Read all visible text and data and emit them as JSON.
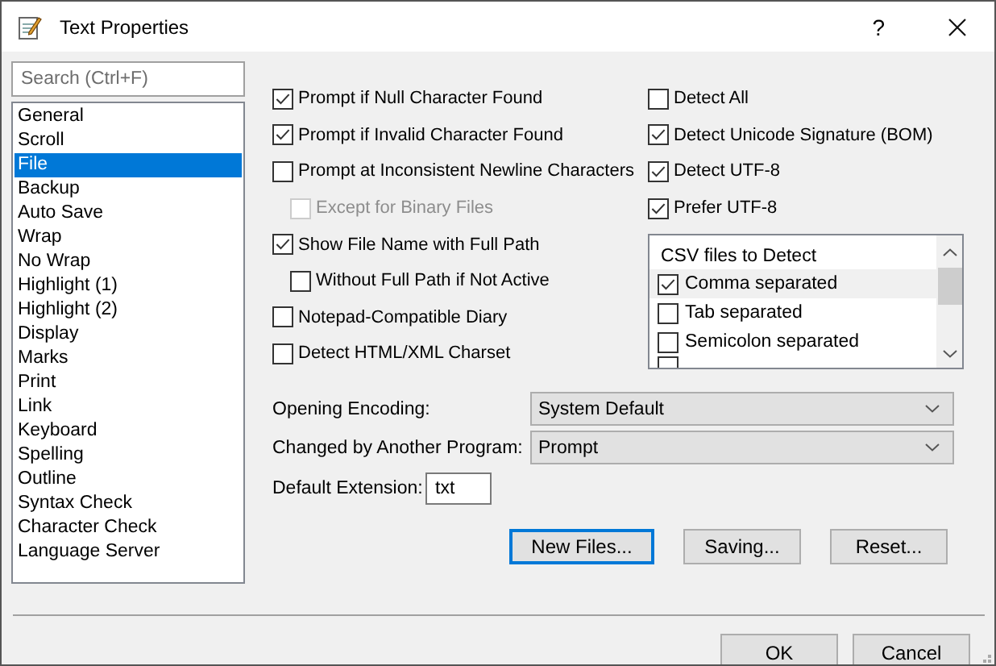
{
  "window": {
    "title": "Text Properties",
    "help": "?"
  },
  "search": {
    "placeholder": "Search (Ctrl+F)"
  },
  "categories": [
    {
      "label": "General",
      "selected": false
    },
    {
      "label": "Scroll",
      "selected": false
    },
    {
      "label": "File",
      "selected": true
    },
    {
      "label": "Backup",
      "selected": false
    },
    {
      "label": "Auto Save",
      "selected": false
    },
    {
      "label": "Wrap",
      "selected": false
    },
    {
      "label": "No Wrap",
      "selected": false
    },
    {
      "label": "Highlight (1)",
      "selected": false
    },
    {
      "label": "Highlight (2)",
      "selected": false
    },
    {
      "label": "Display",
      "selected": false
    },
    {
      "label": "Marks",
      "selected": false
    },
    {
      "label": "Print",
      "selected": false
    },
    {
      "label": "Link",
      "selected": false
    },
    {
      "label": "Keyboard",
      "selected": false
    },
    {
      "label": "Spelling",
      "selected": false
    },
    {
      "label": "Outline",
      "selected": false
    },
    {
      "label": "Syntax Check",
      "selected": false
    },
    {
      "label": "Character Check",
      "selected": false
    },
    {
      "label": "Language Server",
      "selected": false
    }
  ],
  "left_options": [
    {
      "label": "Prompt if Null Character Found",
      "checked": true,
      "disabled": false
    },
    {
      "label": "Prompt if Invalid Character Found",
      "checked": true,
      "disabled": false
    },
    {
      "label": "Prompt at Inconsistent Newline Characters",
      "checked": false,
      "disabled": false,
      "children": [
        {
          "label": "Except for Binary Files",
          "checked": false,
          "disabled": true
        }
      ]
    },
    {
      "label": "Show File Name with Full Path",
      "checked": true,
      "disabled": false,
      "children": [
        {
          "label": "Without Full Path if Not Active",
          "checked": false,
          "disabled": false
        }
      ]
    },
    {
      "label": "Notepad-Compatible Diary",
      "checked": false,
      "disabled": false
    },
    {
      "label": "Detect HTML/XML Charset",
      "checked": false,
      "disabled": false
    }
  ],
  "right_options": [
    {
      "label": "Detect All",
      "checked": false
    },
    {
      "label": "Detect Unicode Signature (BOM)",
      "checked": true
    },
    {
      "label": "Detect UTF-8",
      "checked": true
    },
    {
      "label": "Prefer UTF-8",
      "checked": true
    }
  ],
  "csv_list": {
    "title": "CSV files to Detect",
    "items": [
      {
        "label": "Comma separated",
        "checked": true,
        "selected": true
      },
      {
        "label": "Tab separated",
        "checked": false,
        "selected": false
      },
      {
        "label": "Semicolon separated",
        "checked": false,
        "selected": false
      }
    ]
  },
  "dropdowns": [
    {
      "label": "Opening Encoding:",
      "value": "System Default"
    },
    {
      "label": "Changed by Another Program:",
      "value": "Prompt"
    }
  ],
  "default_extension": {
    "label": "Default Extension:",
    "value": "txt"
  },
  "buttons": [
    {
      "label": "New Files...",
      "focused": true
    },
    {
      "label": "Saving...",
      "focused": false
    },
    {
      "label": "Reset...",
      "focused": false
    }
  ],
  "footer_buttons": [
    {
      "label": "OK"
    },
    {
      "label": "Cancel"
    }
  ]
}
